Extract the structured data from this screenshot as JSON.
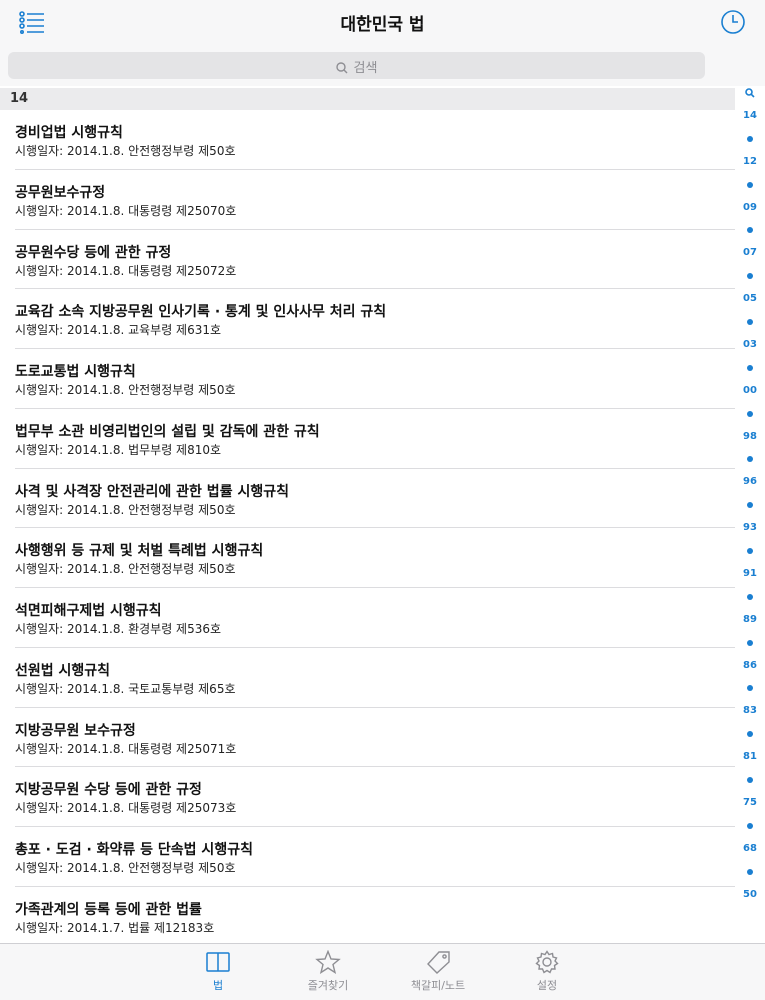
{
  "nav": {
    "title": "대한민국 법"
  },
  "search": {
    "placeholder": "검색"
  },
  "section": {
    "header": "14"
  },
  "rows": [
    {
      "title": "경비업법 시행규칙",
      "sub": "시행일자: 2014.1.8. 안전행정부령 제50호"
    },
    {
      "title": "공무원보수규정",
      "sub": "시행일자: 2014.1.8. 대통령령 제25070호"
    },
    {
      "title": "공무원수당 등에 관한 규정",
      "sub": "시행일자: 2014.1.8. 대통령령 제25072호"
    },
    {
      "title": "교육감 소속 지방공무원 인사기록 · 통계 및 인사사무 처리 규칙",
      "sub": "시행일자: 2014.1.8. 교육부령 제631호"
    },
    {
      "title": "도로교통법 시행규칙",
      "sub": "시행일자: 2014.1.8. 안전행정부령 제50호"
    },
    {
      "title": "법무부 소관 비영리법인의 설립 및 감독에 관한 규칙",
      "sub": "시행일자: 2014.1.8. 법무부령 제810호"
    },
    {
      "title": "사격 및 사격장 안전관리에 관한 법률 시행규칙",
      "sub": "시행일자: 2014.1.8. 안전행정부령 제50호"
    },
    {
      "title": "사행행위 등 규제 및 처벌 특례법 시행규칙",
      "sub": "시행일자: 2014.1.8. 안전행정부령 제50호"
    },
    {
      "title": "석면피해구제법 시행규칙",
      "sub": "시행일자: 2014.1.8. 환경부령 제536호"
    },
    {
      "title": "선원법 시행규칙",
      "sub": "시행일자: 2014.1.8. 국토교통부령 제65호"
    },
    {
      "title": "지방공무원 보수규정",
      "sub": "시행일자: 2014.1.8. 대통령령 제25071호"
    },
    {
      "title": "지방공무원 수당 등에 관한 규정",
      "sub": "시행일자: 2014.1.8. 대통령령 제25073호"
    },
    {
      "title": "총포 · 도검 · 화약류 등 단속법 시행규칙",
      "sub": "시행일자: 2014.1.8. 안전행정부령 제50호"
    },
    {
      "title": "가족관계의 등록 등에 관한 법률",
      "sub": "시행일자: 2014.1.7. 법률 제12183호"
    }
  ],
  "index": [
    "search-icon",
    "14",
    "•",
    "12",
    "•",
    "09",
    "•",
    "07",
    "•",
    "05",
    "•",
    "03",
    "•",
    "00",
    "•",
    "98",
    "•",
    "96",
    "•",
    "93",
    "•",
    "91",
    "•",
    "89",
    "•",
    "86",
    "•",
    "83",
    "•",
    "81",
    "•",
    "75",
    "•",
    "68",
    "•",
    "50"
  ],
  "tabs": [
    {
      "label": "법",
      "icon": "book-icon",
      "active": true
    },
    {
      "label": "즐겨찾기",
      "icon": "star-icon",
      "active": false
    },
    {
      "label": "책갈피/노트",
      "icon": "tag-icon",
      "active": false
    },
    {
      "label": "설정",
      "icon": "gear-icon",
      "active": false
    }
  ],
  "colors": {
    "accent": "#1a7fd1",
    "inactive": "#8e8e93"
  }
}
